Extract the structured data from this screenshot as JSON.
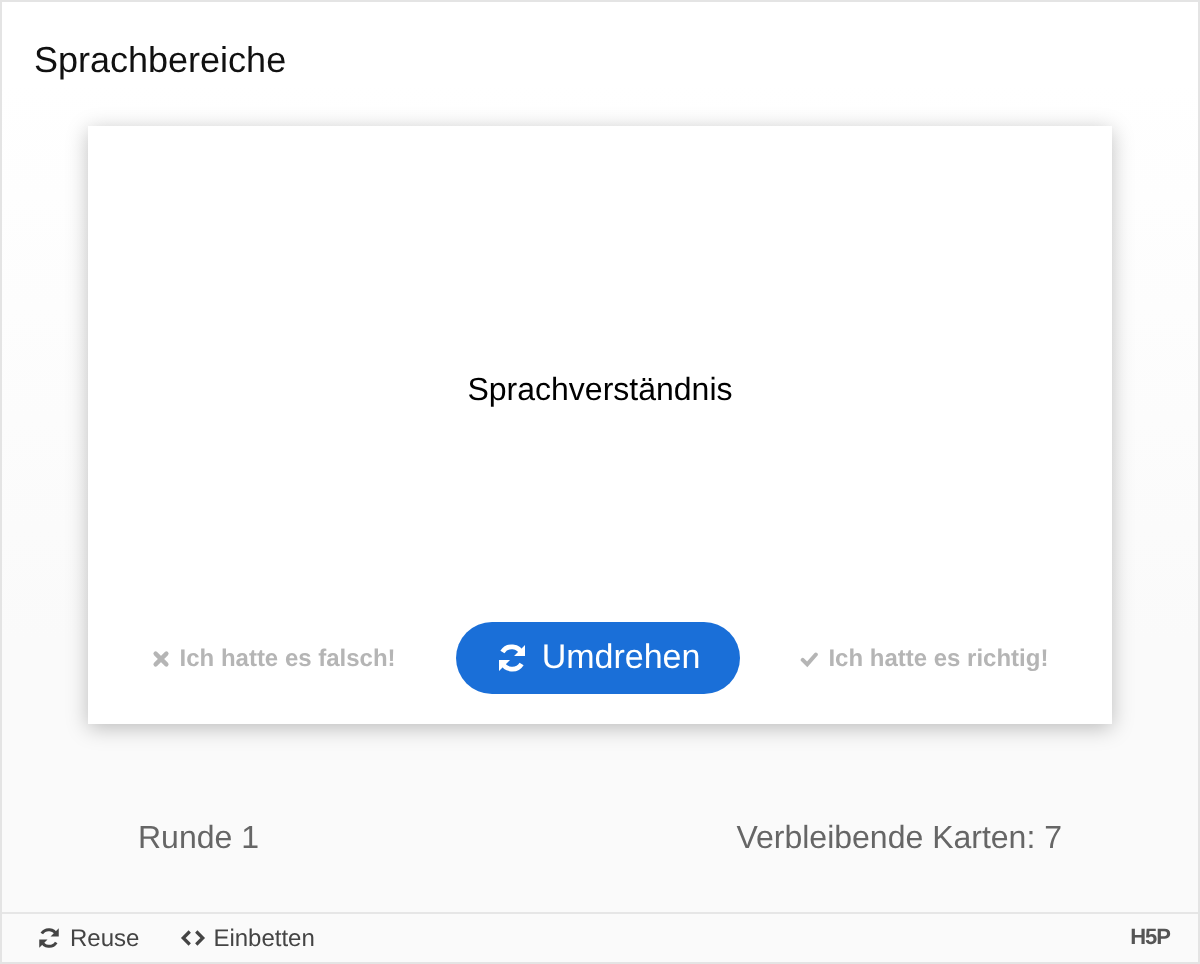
{
  "title": "Sprachbereiche",
  "card": {
    "text": "Sprachverständnis"
  },
  "actions": [
    {
      "kind": "wrong",
      "label": "Ich hatte es falsch!",
      "disabled": true
    },
    {
      "kind": "flip",
      "label": "Umdrehen",
      "disabled": false
    },
    {
      "kind": "right",
      "label": "Ich hatte es richtig!",
      "disabled": true
    }
  ],
  "status": {
    "round": "Runde 1",
    "remaining": "Verbleibende Karten: 7"
  },
  "footer": {
    "links": [
      {
        "kind": "reuse",
        "label": "Reuse"
      },
      {
        "kind": "embed",
        "label": "Einbetten"
      }
    ],
    "logo": "H5P"
  }
}
